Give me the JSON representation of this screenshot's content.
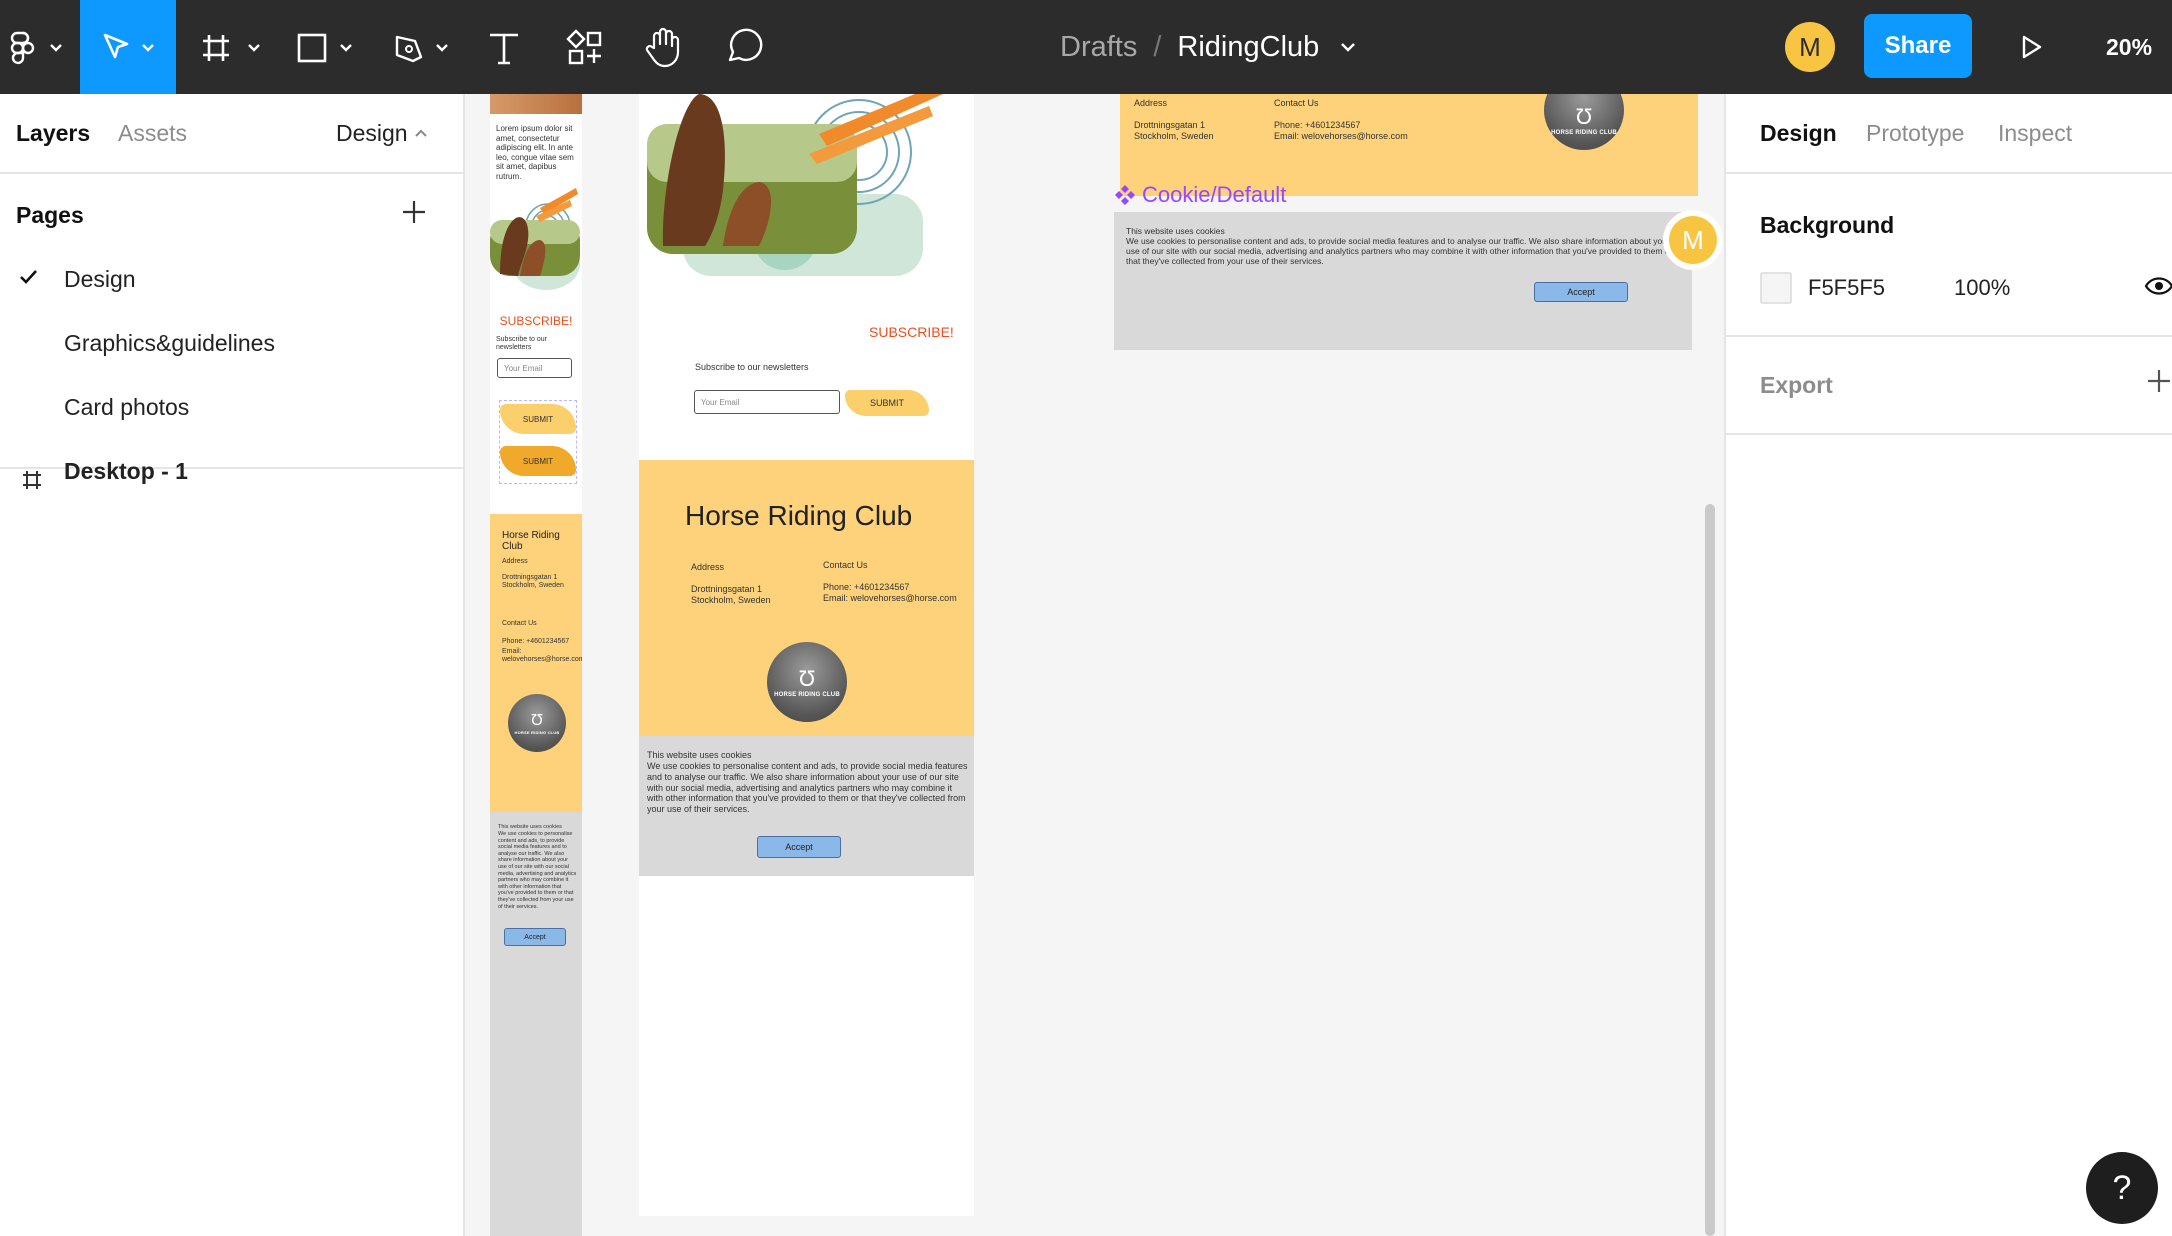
{
  "toolbar": {
    "breadcrumb_drafts": "Drafts",
    "breadcrumb_sep": "/",
    "file_name": "RidingClub",
    "avatar_initial": "M",
    "share_label": "Share",
    "zoom": "20%",
    "active_tool": "move-tool",
    "accent": "#0d99ff"
  },
  "left_panel": {
    "tabs": [
      "Layers",
      "Assets"
    ],
    "page_dropdown": "Design",
    "pages_title": "Pages",
    "pages": [
      {
        "label": "Design",
        "selected": true
      },
      {
        "label": "Graphics&guidelines",
        "selected": false
      },
      {
        "label": "Card photos",
        "selected": false
      }
    ],
    "layers": [
      {
        "label": "Desktop - 1",
        "icon": "frame-icon"
      }
    ]
  },
  "right_panel": {
    "tabs": [
      "Design",
      "Prototype",
      "Inspect"
    ],
    "background_title": "Background",
    "background_hex": "F5F5F5",
    "background_opacity": "100%",
    "export_title": "Export"
  },
  "canvas": {
    "mobile": {
      "lorem": "Lorem ipsum dolor sit amet, consectetur adipiscing elit. In ante leo, congue vitae sem sit amet, dapibus rutrum.",
      "subscribe": "SUBSCRIBE!",
      "newsletter": "Subscribe to our newsletters",
      "email_placeholder": "Your Email",
      "submit": "SUBMIT",
      "submit_hover": "SUBMIT",
      "club_name": "Horse Riding Club",
      "address_title": "Address",
      "address": "Drottningsgatan 1 Stockholm, Sweden",
      "contact_title": "Contact Us",
      "phone": "Phone: +4601234567",
      "email": "Email: welovehorses@horse.com",
      "logo_text": "HORSE RIDING CLUB",
      "cookie_title": "This website uses cookies",
      "cookie_text": "We use cookies to personalise content and ads, to provide social media features and to analyse our traffic. We also share information about your use of our site with our social media, advertising and analytics partners who may combine it with other information that you've provided to them or that they've collected from your use of their services.",
      "accept": "Accept"
    },
    "tablet": {
      "subscribe": "SUBSCRIBE!",
      "newsletter": "Subscribe to our newsletters",
      "email_placeholder": "Your Email",
      "submit": "SUBMIT",
      "club_name": "Horse Riding Club",
      "address_title": "Address",
      "address": "Drottningsgatan 1 Stockholm, Sweden",
      "contact_title": "Contact Us",
      "phone": "Phone: +4601234567",
      "email": "Email: welovehorses@horse.com",
      "logo_text": "HORSE RIDING CLUB",
      "cookie_title": "This website uses cookies",
      "cookie_text": "We use cookies to personalise content and ads, to provide social media features and to analyse our traffic. We also share information about your use of our site with our social media, advertising and analytics partners who may combine it with other information that you've provided to them or that they've collected from your use of their services.",
      "accept": "Accept"
    },
    "desktop": {
      "address_title": "Address",
      "address": "Drottningsgatan 1 Stockholm, Sweden",
      "contact_title": "Contact Us",
      "phone": "Phone: +4601234567",
      "email": "Email: welovehorses@horse.com",
      "logo_text": "HORSE RIDING CLUB",
      "component_label": "Cookie/Default",
      "cookie_title": "This website uses cookies",
      "cookie_text": "We use cookies to personalise content and ads, to provide social media features and to analyse our traffic. We also share information about your use of our site with our social media, advertising and analytics partners who may combine it with other information that you've provided to them or that they've collected from your use of their services.",
      "accept": "Accept",
      "cursor_initial": "M"
    }
  },
  "help": "?"
}
